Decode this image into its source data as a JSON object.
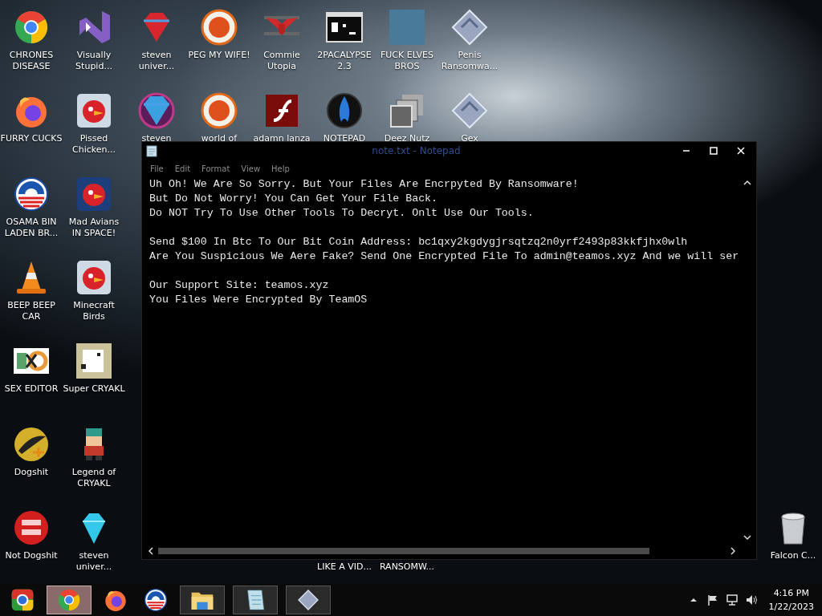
{
  "desktop": {
    "columns": [
      {
        "top": [
          {
            "kind": "ring",
            "label": [
              "CHRONES",
              "DISEASE"
            ]
          },
          {
            "kind": "firefox",
            "label": [
              "FURRY CUCKS"
            ]
          },
          {
            "kind": "campaign",
            "label": [
              "OSAMA BIN",
              "LADEN BR..."
            ]
          },
          {
            "kind": "cone",
            "label": [
              "BEEP BEEP",
              "CAR"
            ]
          },
          {
            "kind": "hex",
            "label": [
              "SEX EDITOR"
            ]
          },
          {
            "kind": "gold",
            "label": [
              "Dogshit"
            ]
          },
          {
            "kind": "reddisc",
            "label": [
              "Not Dogshit"
            ]
          }
        ]
      },
      {
        "top": [
          {
            "kind": "ribbon",
            "label": [
              "Visually",
              "Stupid..."
            ]
          },
          {
            "kind": "birdtile",
            "label": [
              "Pissed",
              "Chicken..."
            ]
          },
          {
            "kind": "birdspace",
            "label": [
              "Mad Avians",
              "IN SPACE!"
            ]
          },
          {
            "kind": "birdtile",
            "label": [
              "Minecraft",
              "Birds"
            ]
          },
          {
            "kind": "pixel",
            "label": [
              "Super CRYAKL"
            ]
          },
          {
            "kind": "character",
            "label": [
              "Legend of",
              "CRYAKL"
            ]
          },
          {
            "kind": "bluegem",
            "label": [
              "steven",
              "univer..."
            ]
          }
        ]
      },
      {
        "top": [
          {
            "kind": "gem",
            "label": [
              "steven",
              "univer..."
            ]
          },
          {
            "kind": "gemring",
            "label": [
              "steven"
            ]
          }
        ]
      },
      {
        "top": [
          {
            "kind": "pball",
            "label": [
              "PEG MY WIFE!"
            ]
          },
          {
            "kind": "pball",
            "label": [
              "world of"
            ]
          }
        ]
      },
      {
        "top": [
          {
            "kind": "wings",
            "label": [
              "Commie",
              "Utopia"
            ]
          },
          {
            "kind": "flash",
            "label": [
              "adamn lanza"
            ]
          }
        ]
      },
      {
        "top": [
          {
            "kind": "terminal",
            "label": [
              "2PACALYPSE",
              "2.3"
            ]
          },
          {
            "kind": "flame",
            "label": [
              "NOTEPAD"
            ]
          }
        ],
        "bottom": [
          {
            "kind": "hidden",
            "label": [
              "LIKE A VID..."
            ]
          }
        ]
      },
      {
        "top": [
          {
            "kind": "photo",
            "label": [
              "FUCK ELVES",
              "BROS"
            ]
          },
          {
            "kind": "stack",
            "label": [
              "Deez Nutz"
            ]
          }
        ],
        "bottom": [
          {
            "kind": "hidden",
            "label": [
              "RANSOMW..."
            ]
          }
        ]
      },
      {
        "top": [
          {
            "kind": "slate",
            "label": [
              "Penis",
              "Ransomwa..."
            ]
          },
          {
            "kind": "slate",
            "label": [
              "Gex"
            ]
          }
        ]
      },
      {
        "bottom": [
          {
            "kind": "bin",
            "label": [
              "Falcon C..."
            ]
          }
        ]
      }
    ]
  },
  "notepad": {
    "title": "note.txt - Notepad",
    "menu": [
      "File",
      "Edit",
      "Format",
      "View",
      "Help"
    ],
    "paragraphs": [
      [
        "Uh Oh! We Are So Sorry. But Your Files Are Encrpyted By Ransomware!",
        "But Do Not Worry! You Can Get Your File Back.",
        "Do NOT Try To Use Other Tools To Decryt. Onlt Use Our Tools."
      ],
      [
        "Send $100 In Btc To Our Bit Coin Address: bc1qxy2kgdygjrsqtzq2n0yrf2493p83kkfjhx0wlh",
        "Are You Suspicious We Aere Fake? Send One Encrypted File To admin@teamos.xyz And we will ser"
      ],
      [
        "Our Support Site: teamos.xyz",
        "You Files Were Encrypted By TeamOS"
      ]
    ]
  },
  "taskbar": {
    "items": [
      {
        "kind": "ringold",
        "running": false,
        "selected": false
      },
      {
        "kind": "ring",
        "running": true,
        "selected": true
      },
      {
        "kind": "firefox",
        "running": false,
        "selected": false
      },
      {
        "kind": "campaign",
        "running": false,
        "selected": false
      },
      {
        "kind": "folder",
        "running": true,
        "selected": false
      },
      {
        "kind": "notepad",
        "running": true,
        "selected": false
      },
      {
        "kind": "slate",
        "running": true,
        "selected": false
      }
    ],
    "time": "4:16 PM",
    "date": "1/22/2023"
  }
}
